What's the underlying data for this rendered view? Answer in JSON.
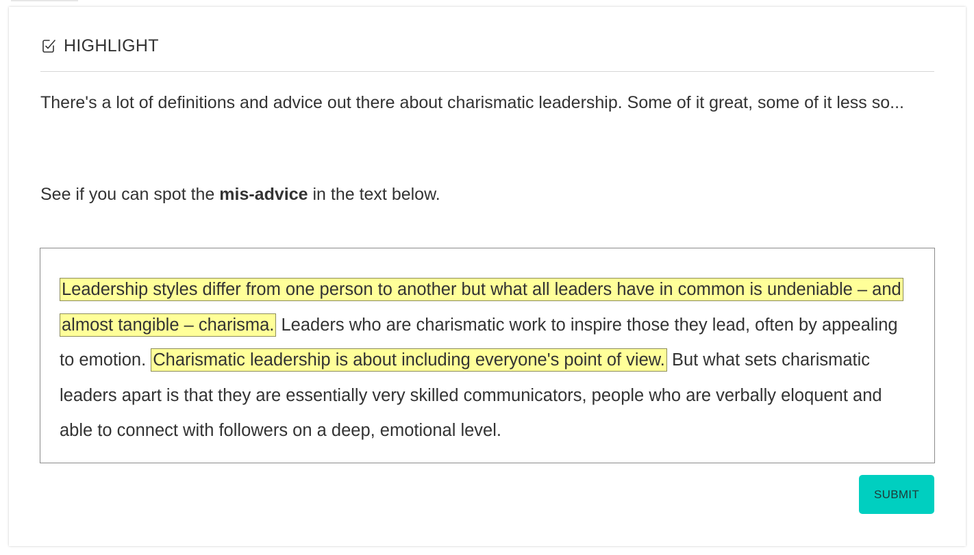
{
  "header": {
    "icon": "checkbox-edit-icon",
    "title": "HIGHLIGHT"
  },
  "intro": {
    "text": "There's a lot of definitions and advice out there about charismatic leadership. Some of it great, some of it less so..."
  },
  "instruction": {
    "before": "See if you can spot the ",
    "bold": "mis-advice",
    "after": " in the text below."
  },
  "passage": {
    "segments": [
      {
        "text": "Leadership styles differ from one person to another but what all leaders have in common is undeniable – and almost tangible – charisma.",
        "highlighted": true
      },
      {
        "text": " Leaders who are charismatic work to inspire those they lead, often by appealing to emotion. ",
        "highlighted": false
      },
      {
        "text": "Charismatic leadership is about including everyone's point of view.",
        "highlighted": true
      },
      {
        "text": " But what sets charismatic leaders apart is that they are essentially very skilled communicators, people who are verbally eloquent and able to connect with followers on a deep, emotional level.",
        "highlighted": false
      }
    ]
  },
  "submit": {
    "label": "SUBMIT"
  },
  "colors": {
    "highlight": "#ffff99",
    "accent": "#00cfc0"
  }
}
